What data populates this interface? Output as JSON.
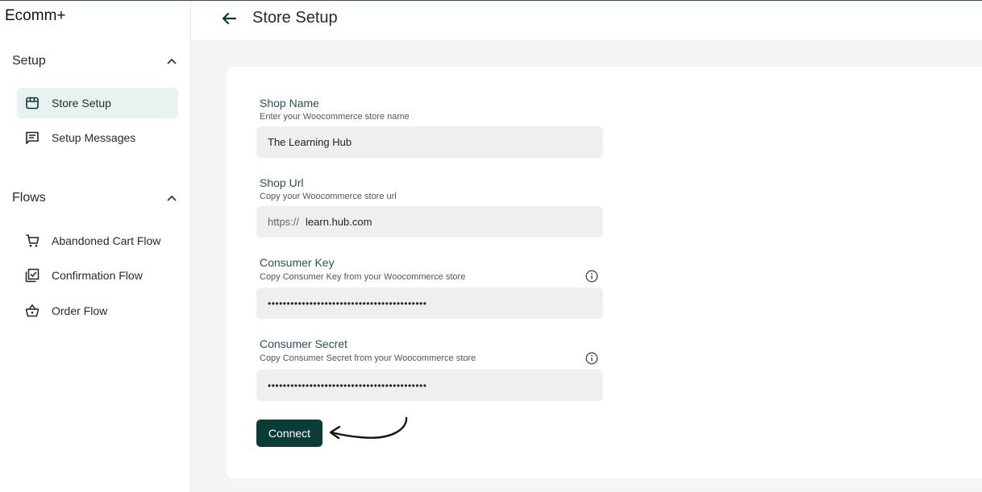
{
  "app": {
    "brand": "Ecomm+"
  },
  "sidebar": {
    "sections": [
      {
        "title": "Setup",
        "items": [
          {
            "label": "Store Setup",
            "icon": "storefront-icon",
            "active": true
          },
          {
            "label": "Setup Messages",
            "icon": "message-icon",
            "active": false
          }
        ]
      },
      {
        "title": "Flows",
        "items": [
          {
            "label": "Abandoned Cart Flow",
            "icon": "cart-icon",
            "active": false
          },
          {
            "label": "Confirmation Flow",
            "icon": "check-box-icon",
            "active": false
          },
          {
            "label": "Order Flow",
            "icon": "basket-icon",
            "active": false
          }
        ]
      }
    ]
  },
  "header": {
    "title": "Store Setup"
  },
  "form": {
    "shop_name": {
      "label": "Shop Name",
      "help": "Enter your Woocommerce store name",
      "value": "The Learning Hub"
    },
    "shop_url": {
      "label": "Shop Url",
      "help": "Copy your Woocommerce store url",
      "prefix": "https://",
      "value": "learn.hub.com"
    },
    "consumer_key": {
      "label": "Consumer Key",
      "help": "Copy Consumer Key from your Woocommerce store",
      "value": "••••••••••••••••••••••••••••••••••••••••••"
    },
    "consumer_secret": {
      "label": "Consumer Secret",
      "help": "Copy Consumer Secret from your Woocommerce store",
      "value": "••••••••••••••••••••••••••••••••••••••••••"
    },
    "connect_label": "Connect"
  },
  "colors": {
    "accent": "#0d3b37",
    "active_bg": "#e8f3f1",
    "input_bg": "#efefef"
  }
}
